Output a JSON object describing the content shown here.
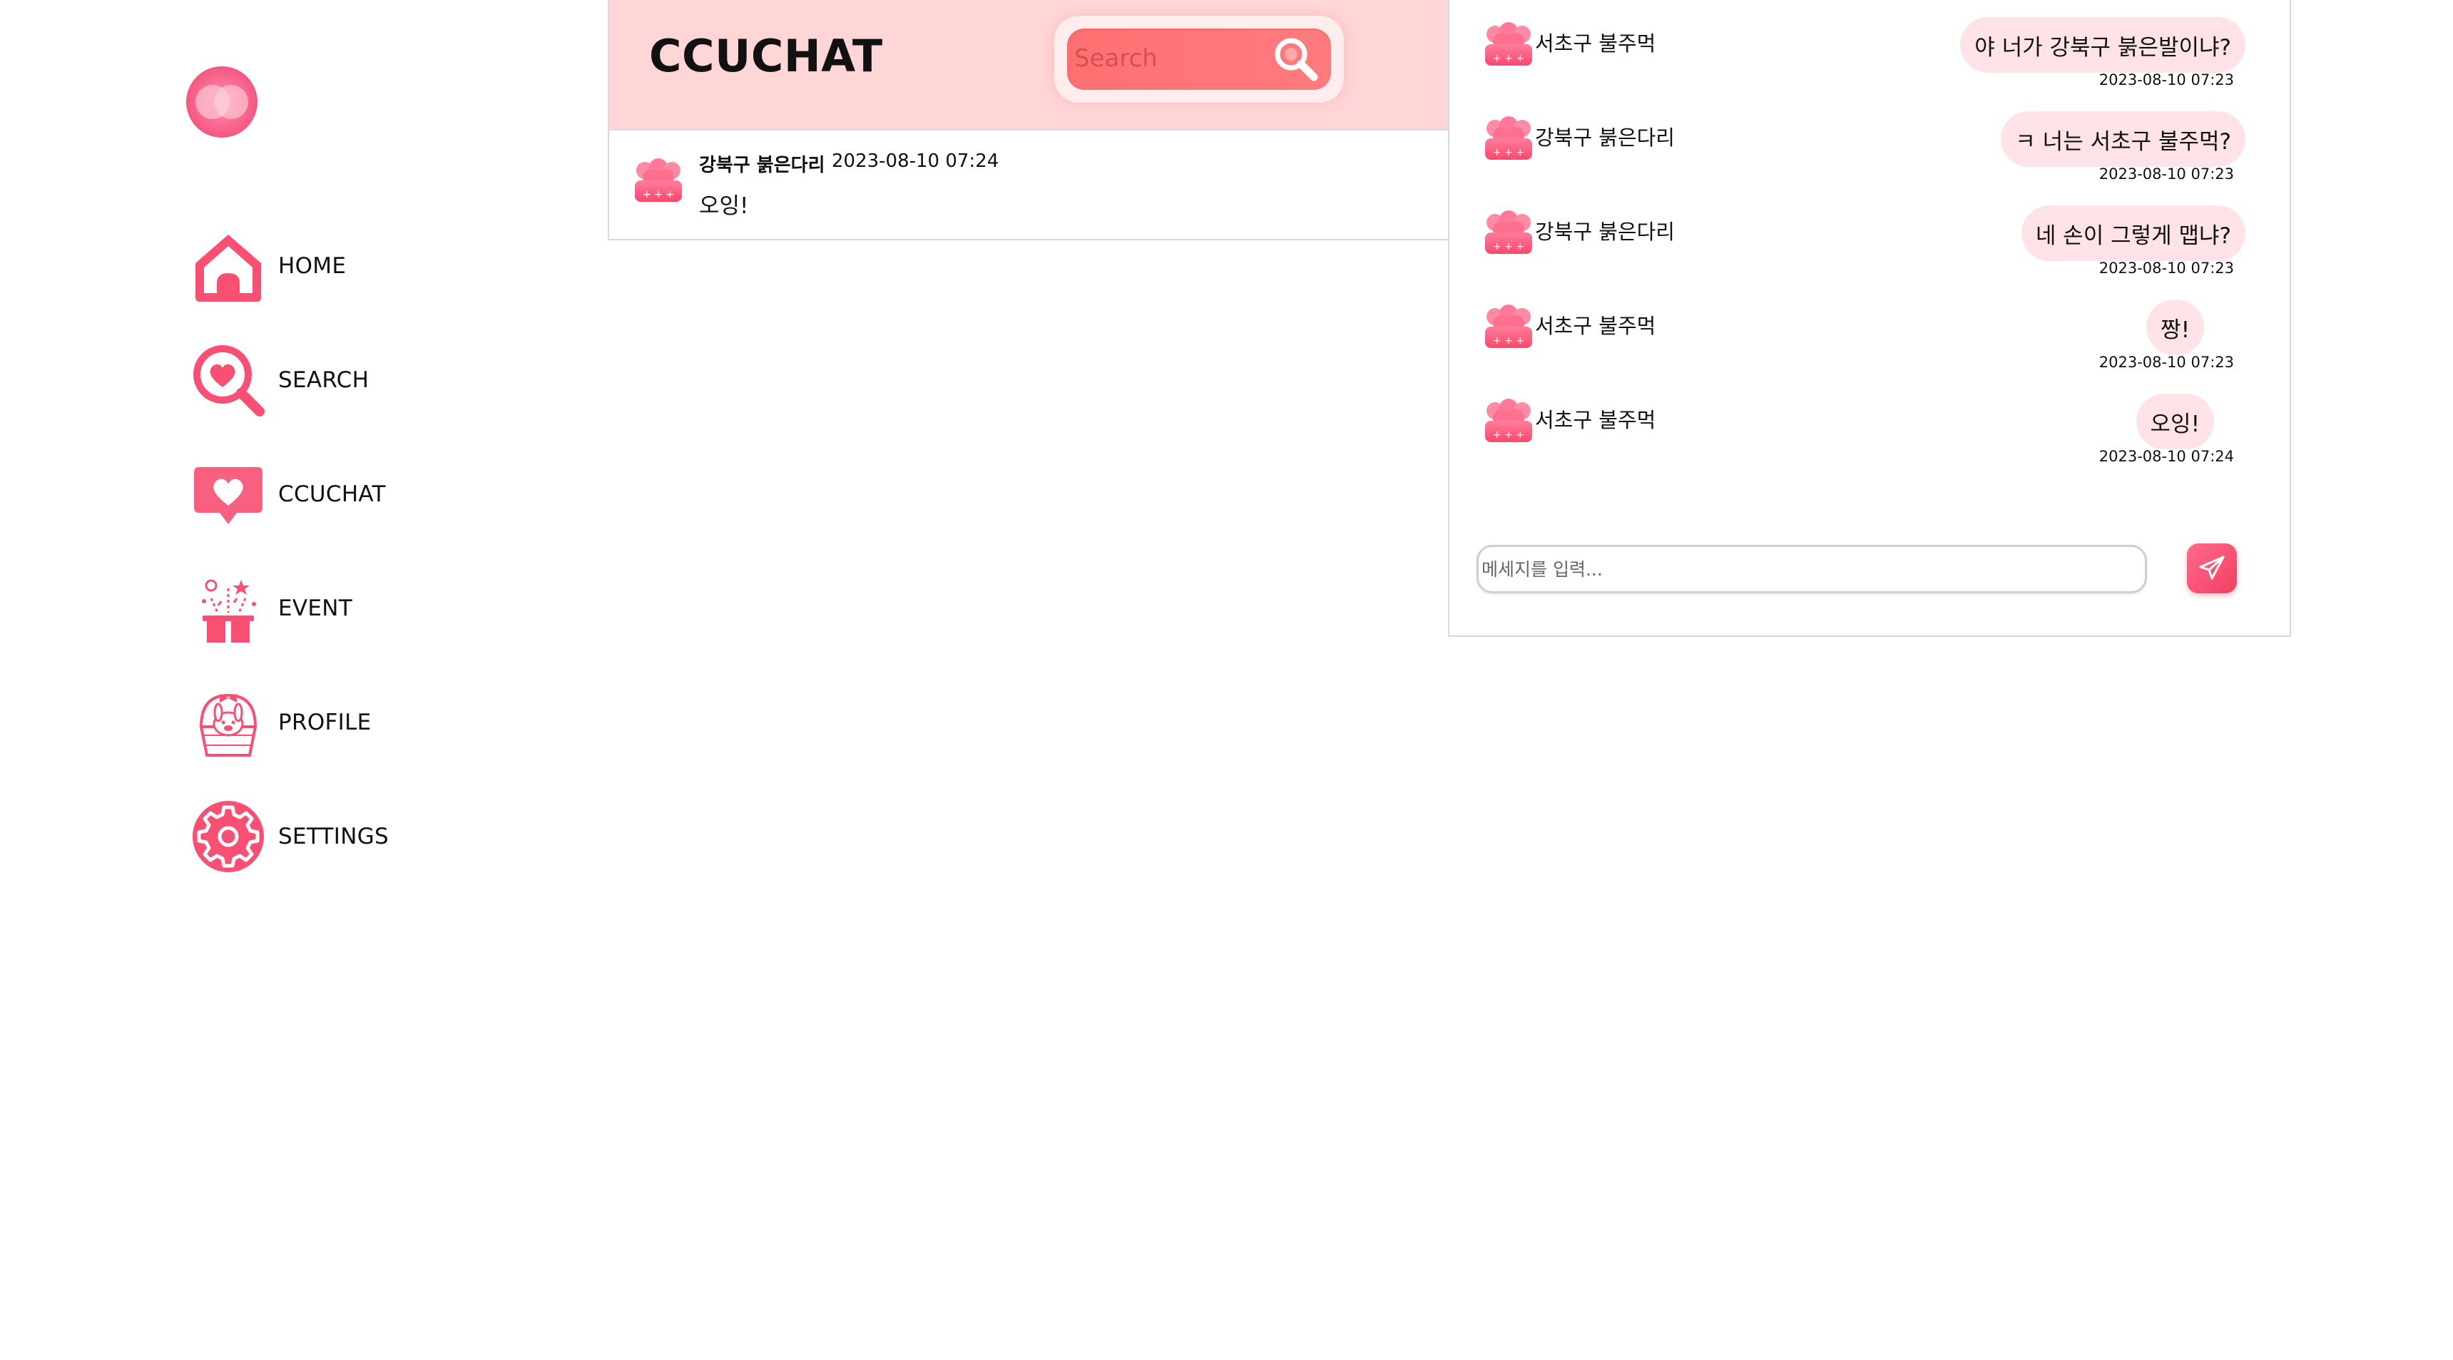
{
  "theme": {
    "accent": "#f94f73",
    "header_background": "#ffd6d8",
    "bubble_background": "#ffe3e6"
  },
  "sidebar": {
    "logo_icon": "app-logo-circles",
    "items": [
      {
        "label": "HOME",
        "icon": "home-icon"
      },
      {
        "label": "SEARCH",
        "icon": "heart-search-icon"
      },
      {
        "label": "CCUCHAT",
        "icon": "heart-chat-icon"
      },
      {
        "label": "EVENT",
        "icon": "gift-icon"
      },
      {
        "label": "PROFILE",
        "icon": "bunny-basket-icon"
      },
      {
        "label": "SETTINGS",
        "icon": "gear-icon"
      }
    ]
  },
  "feed": {
    "title": "CCUCHAT",
    "search": {
      "placeholder": "Search",
      "value": ""
    },
    "items": [
      {
        "author": "강북구 붉은다리",
        "time": "2023-08-10 07:24",
        "text": "오잉!"
      }
    ]
  },
  "chat": {
    "messages": [
      {
        "sender": "서초구 불주먹",
        "text": "야 너가 강북구 붉은발이냐?",
        "time": "2023-08-10 07:23"
      },
      {
        "sender": "강북구 붉은다리",
        "text": "ㅋ 너는 서초구 불주먹?",
        "time": "2023-08-10 07:23"
      },
      {
        "sender": "강북구 붉은다리",
        "text": "네 손이 그렇게 맵냐?",
        "time": "2023-08-10 07:23"
      },
      {
        "sender": "서초구 불주먹",
        "text": "짱!",
        "time": "2023-08-10 07:23"
      },
      {
        "sender": "서초구 불주먹",
        "text": "오잉!",
        "time": "2023-08-10 07:24"
      }
    ],
    "composer": {
      "placeholder": "메세지를 입력...",
      "value": ""
    },
    "send_icon": "paper-plane-icon"
  }
}
